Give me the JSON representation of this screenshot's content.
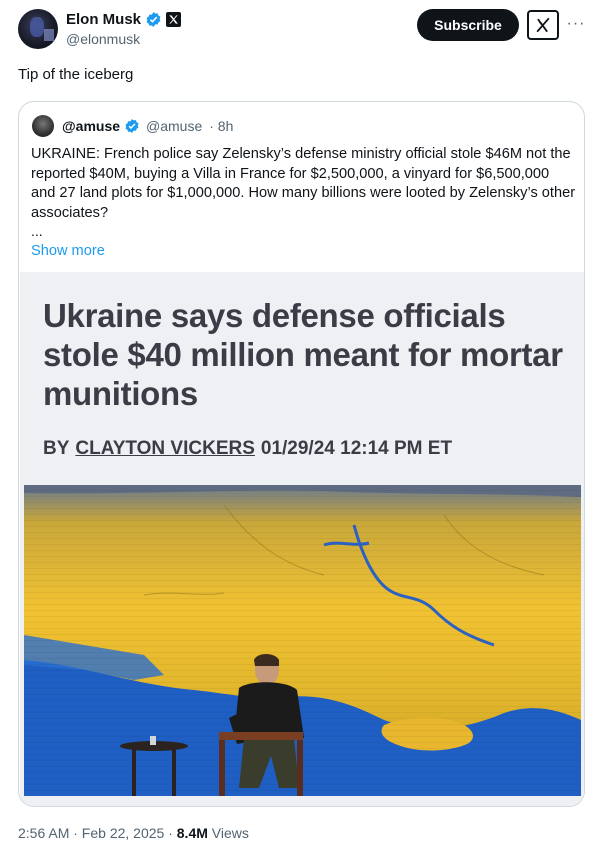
{
  "author": {
    "display_name": "Elon Musk",
    "handle": "@elonmusk",
    "verified": true,
    "affiliation_icon": "x-logo-icon"
  },
  "actions": {
    "subscribe_label": "Subscribe",
    "grok_icon": "grok-icon",
    "more_icon": "more-icon"
  },
  "tweet": {
    "text": "Tip of the iceberg",
    "time": "2:56 AM · Feb 22, 2025 · ",
    "views_count": "8.4M",
    "views_label": " Views"
  },
  "quote": {
    "display_name": "@amuse",
    "handle": "@amuse",
    "time": "· 8h",
    "verified": true,
    "text": "UKRAINE: French police say Zelensky’s defense ministry official stole $46M not the reported $40M, buying a Villa in France for $2,500,000, a vinyard for $6,500,000 and 27 land plots for $1,000,000. How many billions were looted by Zelensky’s other associates?",
    "ellipsis": "...",
    "show_more": "Show more"
  },
  "article": {
    "headline": "Ukraine says defense officials stole $40 million meant for mortar munitions",
    "byline_prefix": "BY",
    "byline_author": "CLAYTON VICKERS",
    "byline_date": "01/29/24 12:14 PM ET"
  },
  "colors": {
    "link": "#1d9bf0",
    "text": "#0f1419",
    "muted": "#536471",
    "verified": "#1d9bf0",
    "map_yellow": "#f1c232",
    "map_blue": "#1f5fc4"
  }
}
